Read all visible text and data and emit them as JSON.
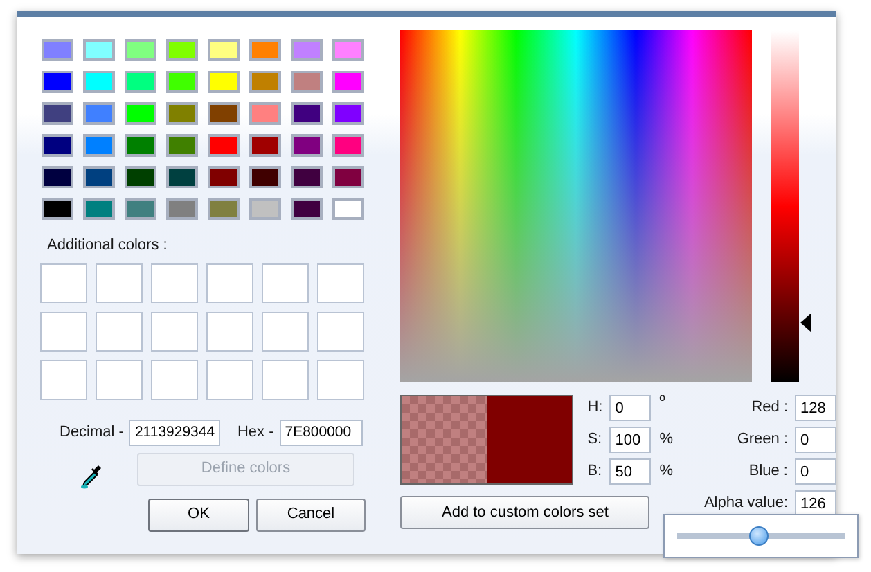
{
  "basic_colors": [
    {
      "color": "#8080ff"
    },
    {
      "color": "#80ffff"
    },
    {
      "color": "#80ff80"
    },
    {
      "color": "#80ff00"
    },
    {
      "color": "#ffff80"
    },
    {
      "color": "#ff8000"
    },
    {
      "color": "#c080ff"
    },
    {
      "color": "#ff80ff"
    },
    {
      "color": "#0000ff"
    },
    {
      "color": "#00ffff"
    },
    {
      "color": "#00ff80"
    },
    {
      "color": "#40ff00"
    },
    {
      "color": "#ffff00"
    },
    {
      "color": "#c08000"
    },
    {
      "color": "#c08080"
    },
    {
      "color": "#ff00ff"
    },
    {
      "color": "#404080"
    },
    {
      "color": "#4080ff"
    },
    {
      "color": "#00ff00"
    },
    {
      "color": "#808000"
    },
    {
      "color": "#804000"
    },
    {
      "color": "#ff8080"
    },
    {
      "color": "#400080"
    },
    {
      "color": "#8000ff"
    },
    {
      "color": "#000080"
    },
    {
      "color": "#0080ff"
    },
    {
      "color": "#008000"
    },
    {
      "color": "#408000"
    },
    {
      "color": "#ff0000"
    },
    {
      "color": "#a00000"
    },
    {
      "color": "#800080"
    },
    {
      "color": "#ff0080"
    },
    {
      "color": "#000040"
    },
    {
      "color": "#004080"
    },
    {
      "color": "#004000"
    },
    {
      "color": "#004040"
    },
    {
      "color": "#800000"
    },
    {
      "color": "#400000"
    },
    {
      "color": "#400040"
    },
    {
      "color": "#800040"
    },
    {
      "color": "#000000"
    },
    {
      "color": "#008080"
    },
    {
      "color": "#408080"
    },
    {
      "color": "#808080"
    },
    {
      "color": "#808040"
    },
    {
      "color": "#c0c0c0"
    },
    {
      "color": "#400040"
    },
    {
      "color": "#ffffff"
    }
  ],
  "additional_colors_label": "Additional colors :",
  "decimal": {
    "label": "Decimal -",
    "value": "2113929344"
  },
  "hex": {
    "label": "Hex -",
    "value": "7E800000"
  },
  "define_button": {
    "label": "Define colors",
    "disabled": true
  },
  "ok_button": {
    "label": "OK"
  },
  "cancel_button": {
    "label": "Cancel"
  },
  "luminance": {
    "level": 0.17
  },
  "preview": {
    "color": "#800000"
  },
  "hsb": [
    {
      "label": "H:",
      "value": "0",
      "unit": "º"
    },
    {
      "label": "S:",
      "value": "100",
      "unit": "%"
    },
    {
      "label": "B:",
      "value": "50",
      "unit": "%"
    }
  ],
  "rgb": [
    {
      "label": "Red :",
      "value": "128"
    },
    {
      "label": "Green :",
      "value": "0"
    },
    {
      "label": "Blue :",
      "value": "0"
    },
    {
      "label": "Alpha value:",
      "value": "126"
    }
  ],
  "add_button": {
    "label": "Add to custom colors set"
  },
  "alpha_slider": {
    "level": 0.49
  }
}
